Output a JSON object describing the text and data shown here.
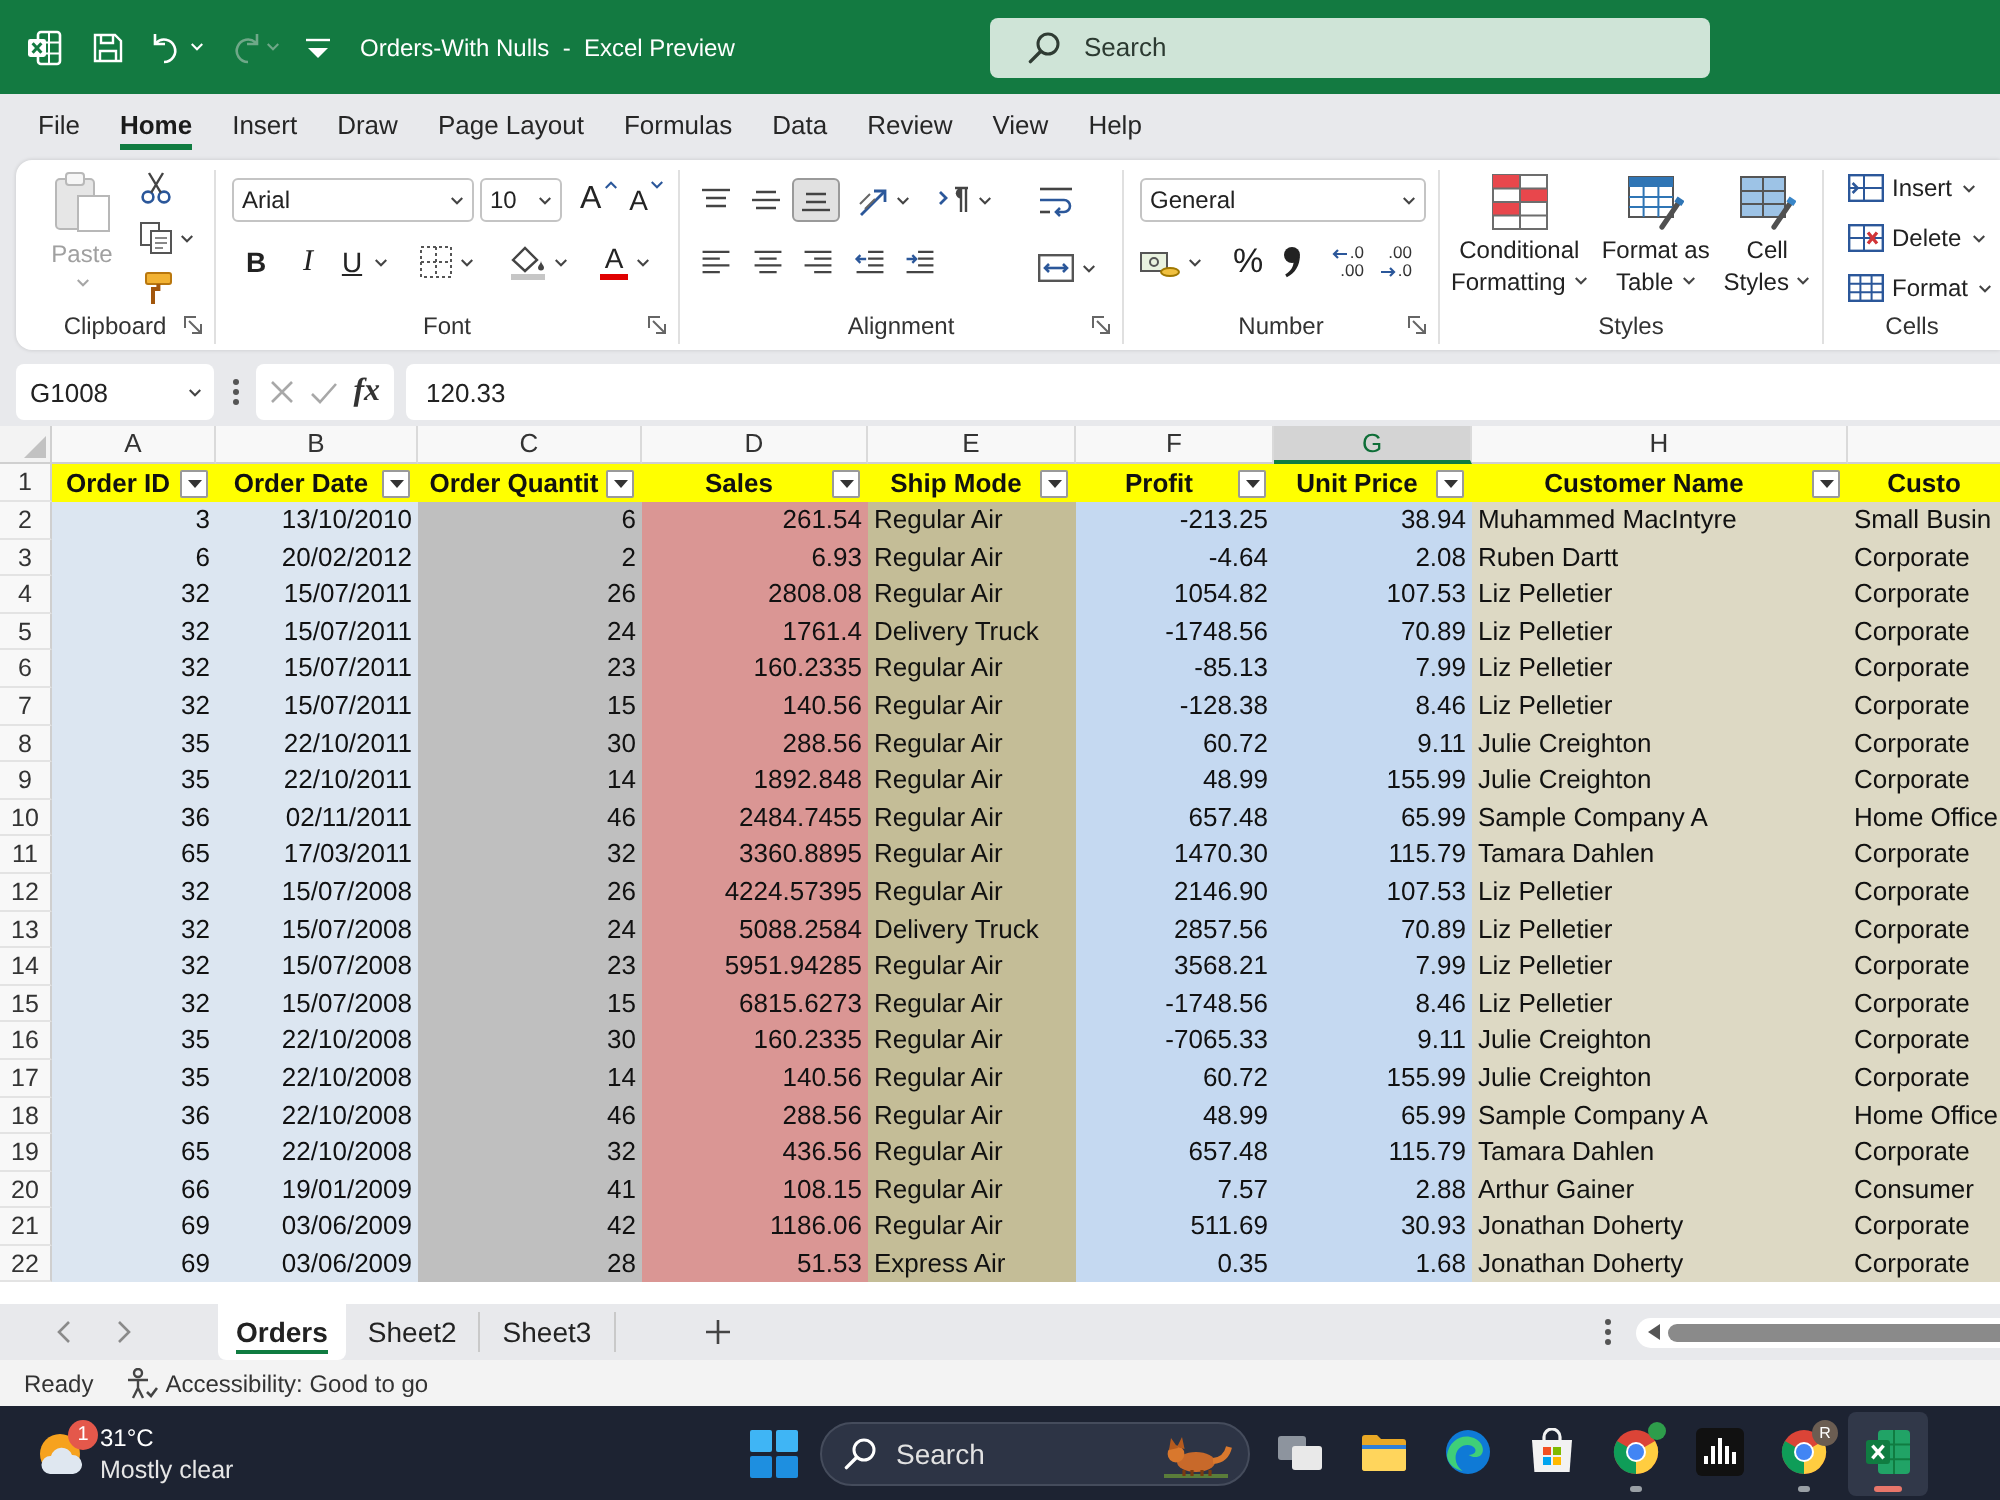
{
  "title_bar": {
    "quick_access": [
      {
        "kind": "save",
        "disabled": false
      },
      {
        "kind": "undo",
        "disabled": false
      },
      {
        "kind": "redo",
        "disabled": true
      },
      {
        "kind": "customize",
        "disabled": false
      }
    ],
    "title": "Orders-With Nulls  -  Excel Preview",
    "search": {
      "placeholder": "Search"
    }
  },
  "menu_tabs": [
    {
      "label": "File",
      "selected": false
    },
    {
      "label": "Home",
      "selected": true
    },
    {
      "label": "Insert",
      "selected": false
    },
    {
      "label": "Draw",
      "selected": false
    },
    {
      "label": "Page Layout",
      "selected": false
    },
    {
      "label": "Formulas",
      "selected": false
    },
    {
      "label": "Data",
      "selected": false
    },
    {
      "label": "Review",
      "selected": false
    },
    {
      "label": "View",
      "selected": false
    },
    {
      "label": "Help",
      "selected": false
    }
  ],
  "ribbon": {
    "clipboard": {
      "label": "Clipboard",
      "paste": {
        "label": "Paste",
        "disabled": true
      }
    },
    "font": {
      "label": "Font",
      "font_name": "Arial",
      "font_size": "10",
      "grow": "A",
      "shrink": "A",
      "bold": "B",
      "italic": "I",
      "underline": "U",
      "font_color": "A"
    },
    "alignment": {
      "label": "Alignment",
      "vertical": [
        {
          "kind": "top",
          "selected": false
        },
        {
          "kind": "middle",
          "selected": false
        },
        {
          "kind": "bottom",
          "selected": true
        }
      ]
    },
    "number": {
      "label": "Number",
      "format": "General",
      "percent": "%",
      "increase_decimal": [
        ".0",
        ".00"
      ],
      "decrease_decimal": [
        ".00",
        ".0"
      ]
    },
    "styles": {
      "label": "Styles",
      "buttons": [
        {
          "kind": "conditional_formatting",
          "lines": [
            "Conditional",
            "Formatting"
          ]
        },
        {
          "kind": "format_as_table",
          "lines": [
            "Format as",
            "Table"
          ]
        },
        {
          "kind": "cell_styles",
          "lines": [
            "Cell",
            "Styles"
          ]
        }
      ]
    },
    "cells": {
      "label": "Cells",
      "buttons": [
        {
          "kind": "insert",
          "label": "Insert"
        },
        {
          "kind": "delete",
          "label": "Delete"
        },
        {
          "kind": "format",
          "label": "Format"
        }
      ]
    }
  },
  "formula_bar": {
    "name_box": "G1008",
    "function_label": "fx",
    "value": "120.33"
  },
  "sheet": {
    "header_row_number": "1",
    "columns": [
      {
        "letter": "A",
        "header": "Order ID",
        "kind": "number",
        "color": "#dce6f1",
        "selected": false,
        "filter": true
      },
      {
        "letter": "B",
        "header": "Order Date",
        "kind": "number",
        "color": "#dce6f1",
        "selected": false,
        "filter": true
      },
      {
        "letter": "C",
        "header": "Order Quantit",
        "kind": "number",
        "color": "#bfbfbf",
        "selected": false,
        "filter": true
      },
      {
        "letter": "D",
        "header": "Sales",
        "kind": "number",
        "color": "#da9694",
        "selected": false,
        "filter": true
      },
      {
        "letter": "E",
        "header": "Ship Mode",
        "kind": "text",
        "color": "#c4bd97",
        "selected": false,
        "filter": true
      },
      {
        "letter": "F",
        "header": "Profit",
        "kind": "number",
        "color": "#c5d9f1",
        "selected": false,
        "filter": true
      },
      {
        "letter": "G",
        "header": "Unit Price",
        "kind": "number",
        "color": "#c5d9f1",
        "selected": true,
        "filter": true
      },
      {
        "letter": "H",
        "header": "Customer Name",
        "kind": "text",
        "color": "#ddd9c4",
        "selected": false,
        "filter": true
      },
      {
        "header": "Custo",
        "kind": "text",
        "color": "#ddd9c4",
        "selected": false,
        "filter": false
      }
    ],
    "rows": [
      {
        "number": "2",
        "cells": [
          "3",
          "13/10/2010",
          "6",
          "261.54",
          "Regular Air",
          "-213.25",
          "38.94",
          "Muhammed MacIntyre",
          "Small Busin"
        ]
      },
      {
        "number": "3",
        "cells": [
          "6",
          "20/02/2012",
          "2",
          "6.93",
          "Regular Air",
          "-4.64",
          "2.08",
          "Ruben Dartt",
          "Corporate"
        ]
      },
      {
        "number": "4",
        "cells": [
          "32",
          "15/07/2011",
          "26",
          "2808.08",
          "Regular Air",
          "1054.82",
          "107.53",
          "Liz Pelletier",
          "Corporate"
        ]
      },
      {
        "number": "5",
        "cells": [
          "32",
          "15/07/2011",
          "24",
          "1761.4",
          "Delivery Truck",
          "-1748.56",
          "70.89",
          "Liz Pelletier",
          "Corporate"
        ]
      },
      {
        "number": "6",
        "cells": [
          "32",
          "15/07/2011",
          "23",
          "160.2335",
          "Regular Air",
          "-85.13",
          "7.99",
          "Liz Pelletier",
          "Corporate"
        ]
      },
      {
        "number": "7",
        "cells": [
          "32",
          "15/07/2011",
          "15",
          "140.56",
          "Regular Air",
          "-128.38",
          "8.46",
          "Liz Pelletier",
          "Corporate"
        ]
      },
      {
        "number": "8",
        "cells": [
          "35",
          "22/10/2011",
          "30",
          "288.56",
          "Regular Air",
          "60.72",
          "9.11",
          "Julie Creighton",
          "Corporate"
        ]
      },
      {
        "number": "9",
        "cells": [
          "35",
          "22/10/2011",
          "14",
          "1892.848",
          "Regular Air",
          "48.99",
          "155.99",
          "Julie Creighton",
          "Corporate"
        ]
      },
      {
        "number": "10",
        "cells": [
          "36",
          "02/11/2011",
          "46",
          "2484.7455",
          "Regular Air",
          "657.48",
          "65.99",
          "Sample Company A",
          "Home Office"
        ]
      },
      {
        "number": "11",
        "cells": [
          "65",
          "17/03/2011",
          "32",
          "3360.8895",
          "Regular Air",
          "1470.30",
          "115.79",
          "Tamara Dahlen",
          "Corporate"
        ]
      },
      {
        "number": "12",
        "cells": [
          "32",
          "15/07/2008",
          "26",
          "4224.57395",
          "Regular Air",
          "2146.90",
          "107.53",
          "Liz Pelletier",
          "Corporate"
        ]
      },
      {
        "number": "13",
        "cells": [
          "32",
          "15/07/2008",
          "24",
          "5088.2584",
          "Delivery Truck",
          "2857.56",
          "70.89",
          "Liz Pelletier",
          "Corporate"
        ]
      },
      {
        "number": "14",
        "cells": [
          "32",
          "15/07/2008",
          "23",
          "5951.94285",
          "Regular Air",
          "3568.21",
          "7.99",
          "Liz Pelletier",
          "Corporate"
        ]
      },
      {
        "number": "15",
        "cells": [
          "32",
          "15/07/2008",
          "15",
          "6815.6273",
          "Regular Air",
          "-1748.56",
          "8.46",
          "Liz Pelletier",
          "Corporate"
        ]
      },
      {
        "number": "16",
        "cells": [
          "35",
          "22/10/2008",
          "30",
          "160.2335",
          "Regular Air",
          "-7065.33",
          "9.11",
          "Julie Creighton",
          "Corporate"
        ]
      },
      {
        "number": "17",
        "cells": [
          "35",
          "22/10/2008",
          "14",
          "140.56",
          "Regular Air",
          "60.72",
          "155.99",
          "Julie Creighton",
          "Corporate"
        ]
      },
      {
        "number": "18",
        "cells": [
          "36",
          "22/10/2008",
          "46",
          "288.56",
          "Regular Air",
          "48.99",
          "65.99",
          "Sample Company A",
          "Home Office"
        ]
      },
      {
        "number": "19",
        "cells": [
          "65",
          "22/10/2008",
          "32",
          "436.56",
          "Regular Air",
          "657.48",
          "115.79",
          "Tamara Dahlen",
          "Corporate"
        ]
      },
      {
        "number": "20",
        "cells": [
          "66",
          "19/01/2009",
          "41",
          "108.15",
          "Regular Air",
          "7.57",
          "2.88",
          "Arthur Gainer",
          "Consumer"
        ]
      },
      {
        "number": "21",
        "cells": [
          "69",
          "03/06/2009",
          "42",
          "1186.06",
          "Regular Air",
          "511.69",
          "30.93",
          "Jonathan Doherty",
          "Corporate"
        ]
      },
      {
        "number": "22",
        "cells": [
          "69",
          "03/06/2009",
          "28",
          "51.53",
          "Express Air",
          "0.35",
          "1.68",
          "Jonathan Doherty",
          "Corporate"
        ]
      }
    ]
  },
  "sheet_tabs": [
    {
      "label": "Orders",
      "selected": true
    },
    {
      "label": "Sheet2",
      "selected": false
    },
    {
      "label": "Sheet3",
      "selected": false
    }
  ],
  "status_bar": {
    "mode": "Ready",
    "accessibility": "Accessibility: Good to go"
  },
  "taskbar": {
    "weather": {
      "badge": "1",
      "temperature": "31°C",
      "condition": "Mostly clear"
    },
    "search": {
      "placeholder": "Search"
    },
    "apps": [
      {
        "kind": "task_view",
        "running": false,
        "active": false,
        "notification": false
      },
      {
        "kind": "file_explorer",
        "running": false,
        "active": false,
        "notification": false
      },
      {
        "kind": "edge",
        "running": false,
        "active": false,
        "notification": false
      },
      {
        "kind": "store",
        "running": false,
        "active": false,
        "notification": false
      },
      {
        "kind": "chrome",
        "running": true,
        "active": false,
        "notification": true
      },
      {
        "kind": "audio",
        "running": false,
        "active": false,
        "notification": false
      },
      {
        "kind": "chrome",
        "running": true,
        "active": false,
        "notification": false,
        "badge": "R"
      },
      {
        "kind": "excel",
        "running": true,
        "active": true,
        "notification": false
      }
    ]
  }
}
